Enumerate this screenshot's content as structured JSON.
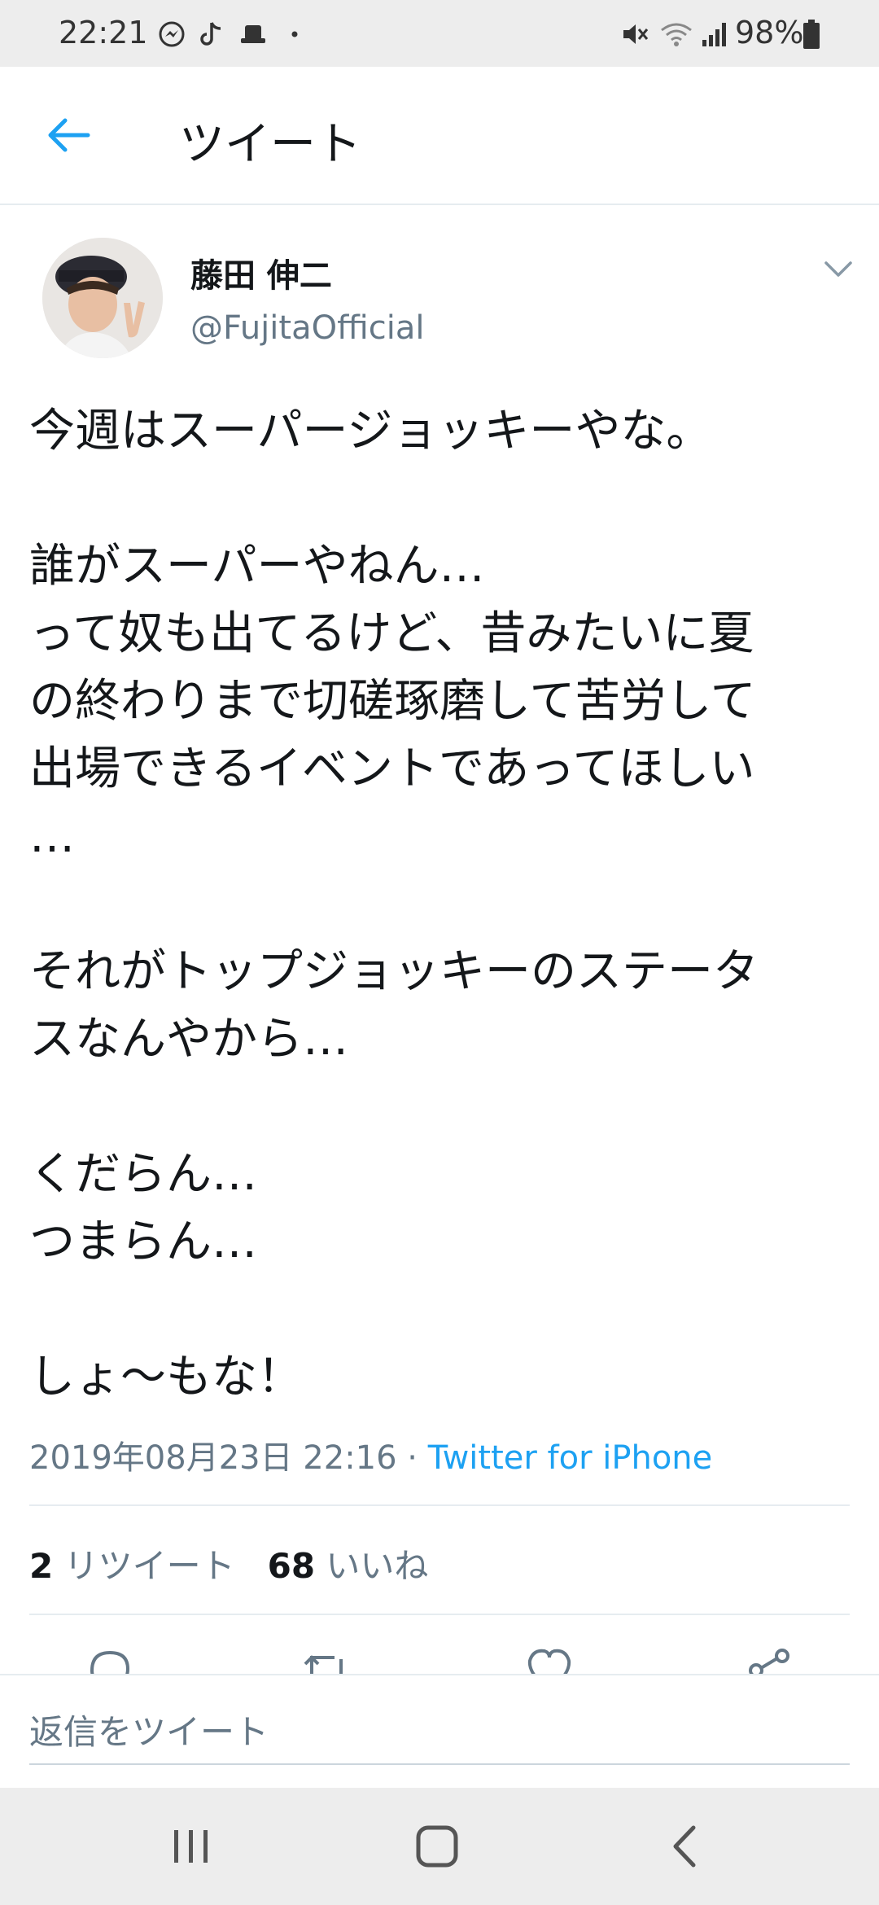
{
  "status_bar": {
    "time": "22:21",
    "battery": "98%",
    "icons": [
      "messenger-icon",
      "tiktok-icon",
      "app-icon",
      "dot-icon",
      "mute-icon",
      "wifi-icon",
      "signal-icon",
      "battery-icon"
    ]
  },
  "header": {
    "title": "ツイート",
    "back_icon": "arrow-left-icon"
  },
  "author": {
    "name": "藤田 伸二",
    "handle": "@FujitaOfficial"
  },
  "tweet": {
    "lines": [
      "今週はスーパージョッキーやな。",
      "",
      "誰がスーパーやねん…",
      "って奴も出てるけど、昔みたいに夏",
      "の終わりまで切磋琢磨して苦労して",
      "出場できるイベントであってほしい",
      "…",
      "",
      "それがトップジョッキーのステータ",
      "スなんやから…",
      "",
      "くだらん…",
      "つまらん…",
      "",
      "しょ〜もな！"
    ],
    "timestamp": "2019年08月23日 22:16",
    "separator": " · ",
    "source": "Twitter for iPhone"
  },
  "stats": {
    "retweet_count": "2",
    "retweet_label": "リツイート",
    "like_count": "68",
    "like_label": "いいね"
  },
  "actions": [
    "reply-icon",
    "retweet-icon",
    "like-icon",
    "share-icon"
  ],
  "reply": {
    "placeholder": "返信をツイート"
  },
  "colors": {
    "accent": "#1da1f2",
    "text": "#14171a",
    "secondary": "#657786",
    "divider": "#e6ecf0"
  }
}
